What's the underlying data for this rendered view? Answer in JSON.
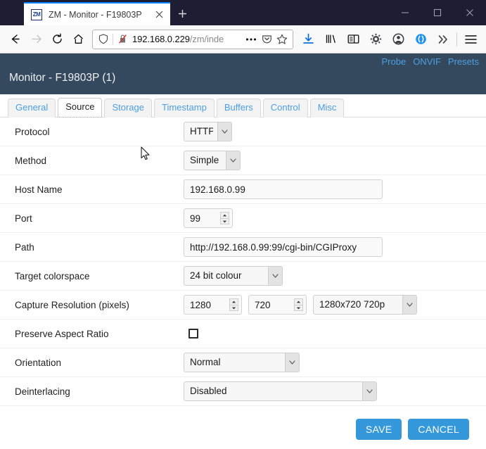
{
  "browser": {
    "tab": {
      "favicon_label": "ZM",
      "favicon_icon": "zoneminder-favicon",
      "title": "ZM - Monitor - F19803P",
      "close_icon": "close-icon"
    },
    "new_tab_label": "+",
    "window_controls": {
      "minimize": "minimize-icon",
      "maximize": "maximize-icon",
      "close": "window-close-icon"
    },
    "nav": {
      "back_icon": "back-arrow-icon",
      "forward_icon": "forward-arrow-icon",
      "reload_icon": "reload-icon",
      "home_icon": "home-icon"
    },
    "urlbar": {
      "shield_icon": "tracking-protection-shield-icon",
      "insecure_icon": "insecure-connection-icon",
      "url_host": "192.168.0.229",
      "url_path": "/zm/inde",
      "page_actions_icon": "page-actions-ellipsis-icon",
      "reader_icon": "pocket-save-icon",
      "bookmark_icon": "bookmark-star-icon"
    },
    "toolbar": {
      "downloads_icon": "downloads-icon",
      "library_icon": "library-icon",
      "sidebar_icon": "sidebar-icon",
      "settings_icon": "gear-settings-icon",
      "account_icon": "account-avatar-icon",
      "container_icon": "container-tabs-icon",
      "overflow_icon": "overflow-chevron-icon",
      "menu_icon": "hamburger-menu-icon"
    }
  },
  "app": {
    "header": {
      "title": "Monitor - F19803P (1)",
      "links": [
        {
          "label": "Probe"
        },
        {
          "label": "ONVIF"
        },
        {
          "label": "Presets"
        }
      ]
    },
    "tabs": [
      {
        "label": "General",
        "active": false
      },
      {
        "label": "Source",
        "active": true
      },
      {
        "label": "Storage",
        "active": false
      },
      {
        "label": "Timestamp",
        "active": false
      },
      {
        "label": "Buffers",
        "active": false
      },
      {
        "label": "Control",
        "active": false
      },
      {
        "label": "Misc",
        "active": false
      }
    ],
    "form": {
      "protocol": {
        "label": "Protocol",
        "value": "HTTP"
      },
      "method": {
        "label": "Method",
        "value": "Simple"
      },
      "host_name": {
        "label": "Host Name",
        "value": "192.168.0.99"
      },
      "port": {
        "label": "Port",
        "value": "99"
      },
      "path": {
        "label": "Path",
        "value": "http://192.168.0.99:99/cgi-bin/CGIProxy"
      },
      "target_colorspace": {
        "label": "Target colorspace",
        "value": "24 bit colour"
      },
      "capture_resolution": {
        "label": "Capture Resolution (pixels)",
        "width": "1280",
        "height": "720",
        "preset": "1280x720 720p"
      },
      "preserve_aspect_ratio": {
        "label": "Preserve Aspect Ratio",
        "checked": false
      },
      "orientation": {
        "label": "Orientation",
        "value": "Normal"
      },
      "deinterlacing": {
        "label": "Deinterlacing",
        "value": "Disabled"
      }
    },
    "buttons": {
      "save": "SAVE",
      "cancel": "CANCEL"
    },
    "colors": {
      "header_bg": "#34495e",
      "link": "#4d9fe0",
      "button": "#3498db",
      "tab_active_text": "#222222"
    }
  }
}
